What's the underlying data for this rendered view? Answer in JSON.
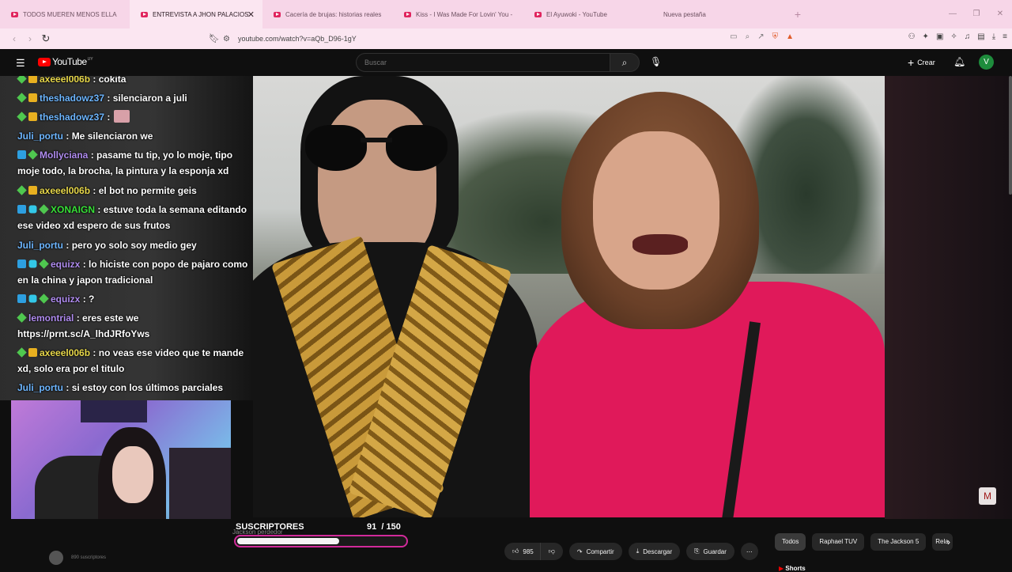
{
  "browser": {
    "tabs": [
      {
        "label": "TODOS MUEREN MENOS ELLA | Hor",
        "active": false
      },
      {
        "label": "ENTREVISTA A JHON PALACIOS",
        "active": true
      },
      {
        "label": "Cacería de brujas: historias reales – C",
        "active": false
      },
      {
        "label": "Kiss - I Was Made For Lovin' You - Yo",
        "active": false
      },
      {
        "label": "El Ayuwoki - YouTube",
        "active": false
      },
      {
        "label": "Nueva pestaña",
        "active": false
      }
    ],
    "close_glyph": "✕",
    "new_tab_glyph": "+",
    "url": "youtube.com/watch?v=aQb_D96-1gY"
  },
  "header": {
    "logo_text": "YouTube",
    "logo_country": "UY",
    "search_placeholder": "Buscar",
    "create_label": "Crear",
    "avatar_letter": "V"
  },
  "chat": {
    "messages": [
      {
        "user": "axeeel006b",
        "text": ": cokita",
        "color": "u-yellow",
        "badges": [
          "b-green",
          "b-yellow"
        ]
      },
      {
        "user": "theshadowz37",
        "text": ": silenciaron a juli",
        "color": "u-blue",
        "badges": [
          "b-green",
          "b-yellow"
        ]
      },
      {
        "user": "theshadowz37",
        "text": ":",
        "color": "u-blue",
        "badges": [
          "b-green",
          "b-yellow"
        ],
        "emote": true
      },
      {
        "user": "Juli_portu",
        "text": ": Me silenciaron we",
        "color": "u-blue",
        "badges": []
      },
      {
        "user": "Mollyciana",
        "text": ": pasame tu tip, yo lo moje, tipo moje todo, la brocha, la pintura y la esponja xd",
        "color": "u-purple",
        "badges": [
          "b-blue",
          "b-green"
        ]
      },
      {
        "user": "axeeel006b",
        "text": ": el bot no permite geis",
        "color": "u-yellow",
        "badges": [
          "b-green",
          "b-yellow"
        ]
      },
      {
        "user": "XONAIGN",
        "text": ": estuve toda la semana editando ese video xd espero de sus frutos",
        "color": "u-green",
        "badges": [
          "b-blue",
          "b-cyan",
          "b-green"
        ]
      },
      {
        "user": "Juli_portu",
        "text": ": pero yo solo soy medio gey",
        "color": "u-blue",
        "badges": []
      },
      {
        "user": "equizx",
        "text": ": lo hiciste con popo de pajaro como en la china y japon tradicional",
        "color": "u-purple",
        "badges": [
          "b-blue",
          "b-cyan",
          "b-green"
        ]
      },
      {
        "user": "equizx",
        "text": ": ?",
        "color": "u-purple",
        "badges": [
          "b-blue",
          "b-cyan",
          "b-green"
        ]
      },
      {
        "user": "lemontrial",
        "text": ": eres este we https://prnt.sc/A_lhdJRfoYws",
        "color": "u-purple",
        "badges": [
          "b-green"
        ]
      },
      {
        "user": "axeeel006b",
        "text": ": no veas ese video que te mande xd, solo era por el titulo",
        "color": "u-yellow",
        "badges": [
          "b-green",
          "b-yellow"
        ]
      },
      {
        "user": "Juli_portu",
        "text": ": si estoy con los últimos parciales",
        "color": "u-blue",
        "badges": []
      }
    ]
  },
  "subgoal": {
    "title": "SUSCRIPTORES",
    "current": "91",
    "target": "/ 150",
    "progress": 0.61,
    "ghost": "Jackson perdedor"
  },
  "below": {
    "channel_subs": "890 suscriptores",
    "like_count": "985",
    "share_label": "Compartir",
    "download_label": "Descargar",
    "save_label": "Guardar",
    "chips": [
      "Todos",
      "Raphael TUV",
      "The Jackson 5",
      "Rela"
    ],
    "shorts_label": "Shorts"
  },
  "overlay": {
    "corner_logo": "M"
  },
  "colors": {
    "accent": "#ff0000",
    "tabbar": "#f7d6e8",
    "goal_border": "#d12a9a"
  }
}
